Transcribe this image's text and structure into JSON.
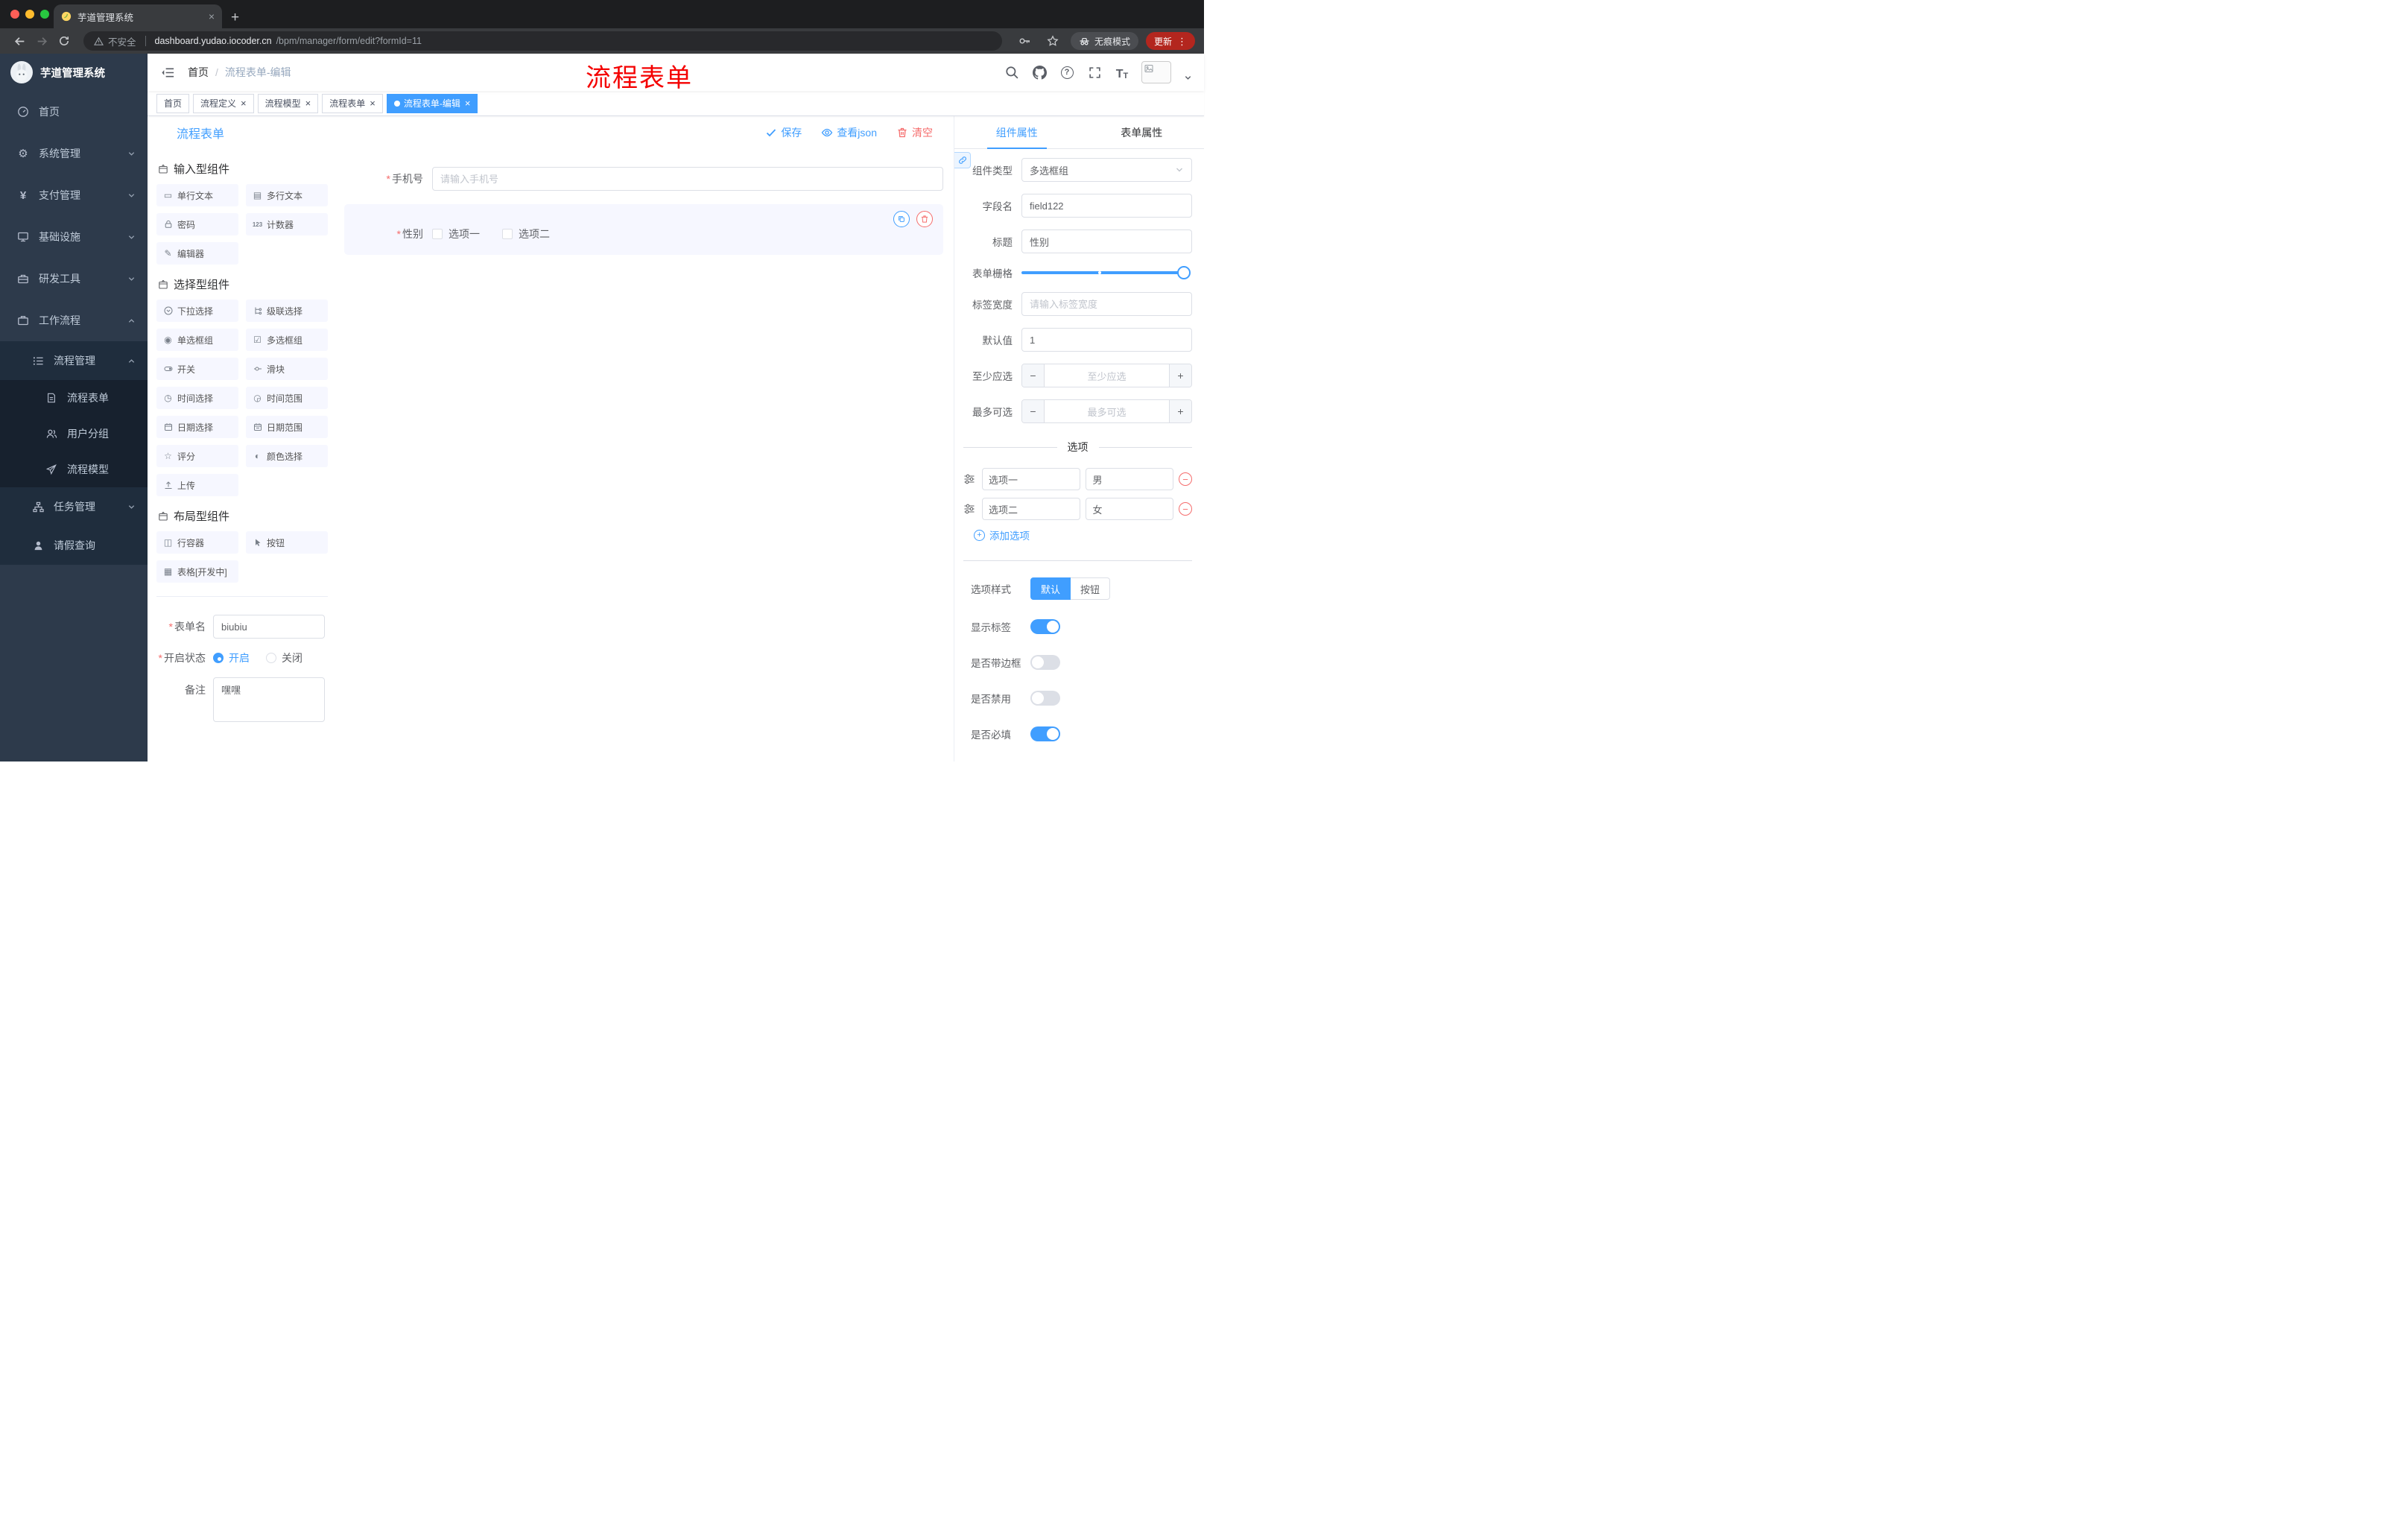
{
  "theme": {
    "accent": "#409eff",
    "danger": "#f56c6c",
    "sidebar_bg": "#2d3a4b",
    "submenu_bg": "#1f2d3d",
    "submenu_deep_bg": "#17212e",
    "active_tag_bg": "#409eff",
    "annotation_color": "#f40000"
  },
  "ui": {
    "required_mark": "*",
    "close_glyph": "×",
    "plus_glyph": "+",
    "minus_glyph": "−",
    "dots_glyph": "⋮",
    "newtab_glyph": "+"
  },
  "browser": {
    "tab_title": "芋道管理系统",
    "security_label": "不安全",
    "url_domain": "dashboard.yudao.iocoder.cn",
    "url_path": "/bpm/manager/form/edit?formId=11",
    "incognito_label": "无痕模式",
    "update_label": "更新"
  },
  "sidebar": {
    "logo_title": "芋道管理系统",
    "items": [
      {
        "label": "首页",
        "icon": "dashboard-icon"
      },
      {
        "label": "系统管理",
        "icon": "gear-icon"
      },
      {
        "label": "支付管理",
        "icon": "yen-icon"
      },
      {
        "label": "基础设施",
        "icon": "monitor-icon"
      },
      {
        "label": "研发工具",
        "icon": "toolbox-icon"
      },
      {
        "label": "工作流程",
        "icon": "briefcase-icon"
      }
    ],
    "process_mgmt": {
      "label": "流程管理",
      "icon": "list-icon"
    },
    "children": [
      {
        "label": "流程表单",
        "icon": "document-icon"
      },
      {
        "label": "用户分组",
        "icon": "users-icon"
      },
      {
        "label": "流程模型",
        "icon": "paper-plane-icon"
      }
    ],
    "task_mgmt": {
      "label": "任务管理",
      "icon": "tree-icon"
    },
    "leave_query": {
      "label": "请假查询",
      "icon": "person-icon"
    }
  },
  "navbar": {
    "breadcrumb_home": "首页",
    "breadcrumb_sep": "/",
    "breadcrumb_current": "流程表单-编辑",
    "annotation": "流程表单"
  },
  "tags": [
    {
      "label": "首页",
      "closable": false,
      "active": false
    },
    {
      "label": "流程定义",
      "closable": true,
      "active": false
    },
    {
      "label": "流程模型",
      "closable": true,
      "active": false
    },
    {
      "label": "流程表单",
      "closable": true,
      "active": false
    },
    {
      "label": "流程表单-编辑",
      "closable": true,
      "active": true
    }
  ],
  "builder": {
    "title": "流程表单",
    "save_label": "保存",
    "view_json_label": "查看json",
    "clear_label": "清空",
    "groups": [
      {
        "title": "输入型组件",
        "icon": "component-box-icon",
        "items": [
          {
            "label": "单行文本",
            "icon": "single-line-text-icon"
          },
          {
            "label": "多行文本",
            "icon": "multi-line-text-icon"
          },
          {
            "label": "密码",
            "icon": "lock-icon"
          },
          {
            "label": "计数器",
            "icon": "counter-icon"
          },
          {
            "label": "编辑器",
            "icon": "editor-icon"
          }
        ]
      },
      {
        "title": "选择型组件",
        "icon": "component-box-icon",
        "items": [
          {
            "label": "下拉选择",
            "icon": "dropdown-icon"
          },
          {
            "label": "级联选择",
            "icon": "cascader-icon"
          },
          {
            "label": "单选框组",
            "icon": "radio-group-icon"
          },
          {
            "label": "多选框组",
            "icon": "checkbox-group-icon"
          },
          {
            "label": "开关",
            "icon": "switch-icon"
          },
          {
            "label": "滑块",
            "icon": "slider-icon"
          },
          {
            "label": "时间选择",
            "icon": "time-picker-icon"
          },
          {
            "label": "时间范围",
            "icon": "time-range-icon"
          },
          {
            "label": "日期选择",
            "icon": "date-picker-icon"
          },
          {
            "label": "日期范围",
            "icon": "date-range-icon"
          },
          {
            "label": "评分",
            "icon": "rate-icon"
          },
          {
            "label": "颜色选择",
            "icon": "color-picker-icon"
          },
          {
            "label": "上传",
            "icon": "upload-icon"
          }
        ]
      },
      {
        "title": "布局型组件",
        "icon": "component-box-icon",
        "items": [
          {
            "label": "行容器",
            "icon": "row-container-icon"
          },
          {
            "label": "按钮",
            "icon": "button-icon"
          },
          {
            "label": "表格[开发中]",
            "icon": "table-icon"
          }
        ]
      }
    ],
    "meta": {
      "form_name": {
        "label": "表单名",
        "value": "biubiu",
        "required": true
      },
      "status": {
        "label": "开启状态",
        "required": true,
        "options": [
          {
            "label": "开启",
            "selected": true
          },
          {
            "label": "关闭",
            "selected": false
          }
        ]
      },
      "remark": {
        "label": "备注",
        "value": "嘿嘿"
      }
    }
  },
  "canvas": {
    "phone": {
      "label": "手机号",
      "placeholder": "请输入手机号",
      "required": true
    },
    "gender": {
      "label": "性别",
      "required": true,
      "options": [
        {
          "label": "选项一",
          "checked": false
        },
        {
          "label": "选项二",
          "checked": false
        }
      ]
    }
  },
  "props": {
    "tabs": [
      {
        "label": "组件属性",
        "active": true
      },
      {
        "label": "表单属性",
        "active": false
      }
    ],
    "component_type": {
      "label": "组件类型",
      "value": "多选框组"
    },
    "field_name": {
      "label": "字段名",
      "value": "field122"
    },
    "title": {
      "label": "标题",
      "value": "性别"
    },
    "grid": {
      "label": "表单栅格"
    },
    "label_width": {
      "label": "标签宽度",
      "placeholder": "请输入标签宽度"
    },
    "default_value": {
      "label": "默认值",
      "value": "1"
    },
    "min_select": {
      "label": "至少应选",
      "placeholder": "至少应选"
    },
    "max_select": {
      "label": "最多可选",
      "placeholder": "最多可选"
    },
    "options": {
      "divider_title": "选项",
      "rows": [
        {
          "name": "选项一",
          "value": "男"
        },
        {
          "name": "选项二",
          "value": "女"
        }
      ],
      "add_label": "添加选项"
    },
    "style": {
      "label": "选项样式",
      "choices": [
        {
          "label": "默认",
          "selected": true
        },
        {
          "label": "按钮",
          "selected": false
        }
      ],
      "toggles": [
        {
          "label": "显示标签",
          "on": true
        },
        {
          "label": "是否带边框",
          "on": false
        },
        {
          "label": "是否禁用",
          "on": false
        },
        {
          "label": "是否必填",
          "on": true
        }
      ]
    }
  }
}
